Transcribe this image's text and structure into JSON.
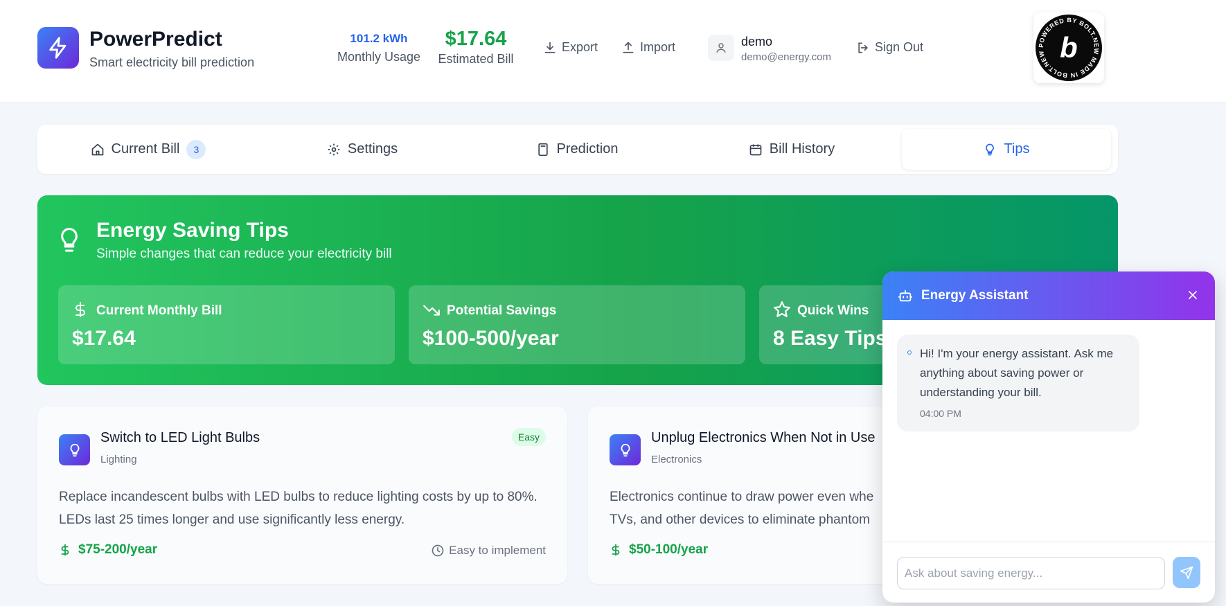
{
  "header": {
    "app_name": "PowerPredict",
    "tagline": "Smart electricity bill prediction",
    "usage_value": "101.2 kWh",
    "usage_label": "Monthly Usage",
    "bill_value": "$17.64",
    "bill_label": "Estimated Bill",
    "export_label": "Export",
    "import_label": "Import",
    "user_name": "demo",
    "user_email": "demo@energy.com",
    "signout_label": "Sign Out",
    "badge_text": "POWERED BY BOLT.NEW MADE IN BOLT.NEW"
  },
  "tabs": [
    {
      "label": "Current Bill",
      "badge": "3",
      "icon": "home-icon"
    },
    {
      "label": "Settings",
      "icon": "gear-icon"
    },
    {
      "label": "Prediction",
      "icon": "calculator-icon"
    },
    {
      "label": "Bill History",
      "icon": "calendar-icon"
    },
    {
      "label": "Tips",
      "icon": "lightbulb-icon",
      "active": true
    }
  ],
  "hero": {
    "title": "Energy Saving Tips",
    "subtitle": "Simple changes that can reduce your electricity bill",
    "cards": [
      {
        "label": "Current Monthly Bill",
        "value": "$17.64",
        "icon": "dollar-icon"
      },
      {
        "label": "Potential Savings",
        "value": "$100-500/year",
        "icon": "trending-down-icon"
      },
      {
        "label": "Quick Wins",
        "value": "8 Easy Tips",
        "icon": "star-icon"
      }
    ]
  },
  "tips": [
    {
      "title": "Switch to LED Light Bulbs",
      "category": "Lighting",
      "difficulty": "Easy",
      "description": "Replace incandescent bulbs with LED bulbs to reduce lighting costs by up to 80%. LEDs last 25 times longer and use significantly less energy.",
      "savings": "$75-200/year",
      "effort": "Easy to implement"
    },
    {
      "title": "Unplug Electronics When Not in Use",
      "category": "Electronics",
      "description": "Electronics continue to draw power even whe TVs, and other devices to eliminate phantom",
      "savings": "$50-100/year"
    }
  ],
  "chat": {
    "title": "Energy Assistant",
    "message": "Hi! I'm your energy assistant. Ask me anything about saving power or understanding your bill.",
    "time": "04:00 PM",
    "placeholder": "Ask about saving energy..."
  },
  "colors": {
    "brand_gradient_start": "#3b82f6",
    "brand_gradient_end": "#6d28d9",
    "accent_blue": "#2563eb",
    "savings_green": "#16a34a",
    "hero_green": "#22c55e"
  }
}
